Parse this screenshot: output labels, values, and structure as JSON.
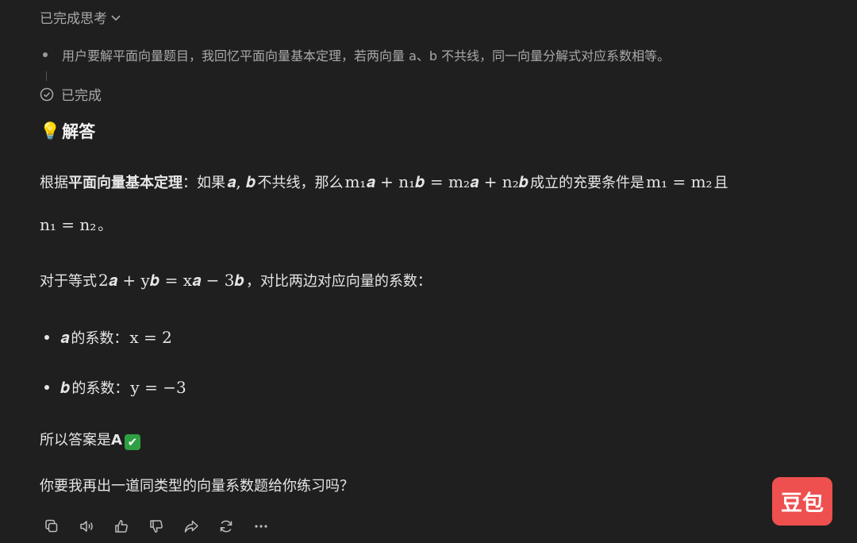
{
  "thinking": {
    "toggle_label": "已完成思考",
    "summary": "用户要解平面向量题目，我回忆平面向量基本定理，若两向量 a、b 不共线，同一向量分解式对应系数相等。",
    "status": "已完成"
  },
  "answer": {
    "heading_emoji": "💡",
    "heading": "解答",
    "p1": {
      "t1": "根据",
      "strong": "平面向量基本定理",
      "t2": "：如果",
      "m1": "𝒂, 𝒃",
      "t3": "不共线，那么",
      "m2": "m₁𝒂 + n₁𝒃 = m₂𝒂 + n₂𝒃",
      "t4": "成立的充要条件是",
      "m3": "m₁ = m₂",
      "t5": "且",
      "m4": "n₁ = n₂",
      "t6": "。"
    },
    "p2": {
      "t1": "对于等式",
      "m1": "2𝒂 + y𝒃 = x𝒂 − 3𝒃",
      "t2": "，对比两边对应向量的系数："
    },
    "bullets": [
      {
        "m1": "𝒂",
        "t1": "的系数：",
        "m2": "x = 2"
      },
      {
        "m1": "𝒃",
        "t1": "的系数：",
        "m2": "y = −3"
      }
    ],
    "p3": {
      "t1": "所以答案是",
      "strong": "A",
      "emoji": "✔"
    },
    "p4": "你要我再出一道同类型的向量系数题给你练习吗？"
  },
  "toolbar": {
    "icons": [
      "copy-icon",
      "speaker-icon",
      "thumbs-up-icon",
      "thumbs-down-icon",
      "share-icon",
      "regenerate-icon",
      "more-icon"
    ]
  },
  "watermark": "豆包"
}
